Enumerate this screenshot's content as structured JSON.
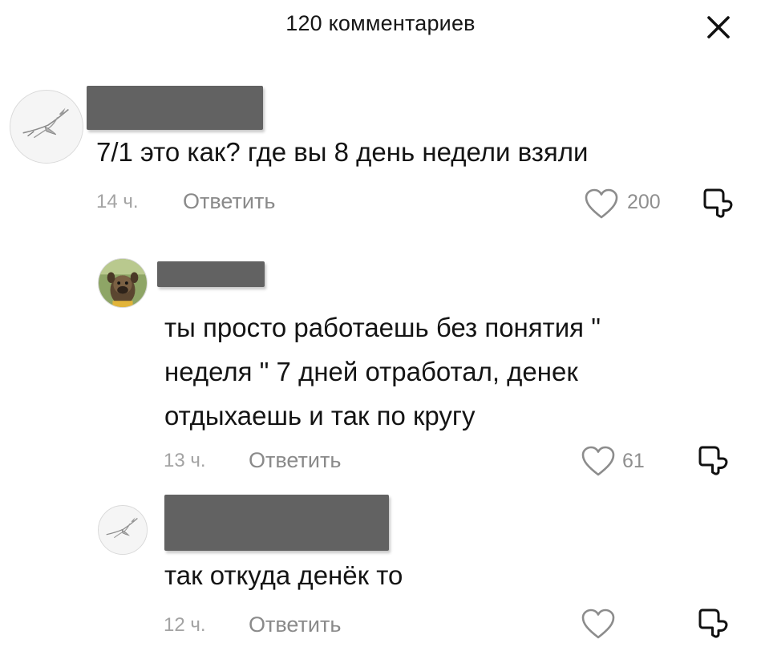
{
  "header": {
    "title": "120 комментариев"
  },
  "comments": [
    {
      "text_lines": [
        "7/1 это как? где вы 8 день недели взяли"
      ],
      "time": "14 ч.",
      "reply_label": "Ответить",
      "likes": "200",
      "avatar_icon": "bird-sketch-avatar"
    },
    {
      "text_lines": [
        "ты просто работаешь без понятия \"",
        "неделя \" 7 дней отработал, денек",
        "отдыхаешь и так по кругу"
      ],
      "time": "13 ч.",
      "reply_label": "Ответить",
      "likes": "61",
      "avatar_icon": "dog-photo-avatar"
    },
    {
      "text_lines": [
        "так откуда денёк то"
      ],
      "time": "12 ч.",
      "reply_label": "Ответить",
      "likes": "",
      "avatar_icon": "bird-sketch-avatar"
    }
  ],
  "icons": {
    "close": "close-icon",
    "like": "heart-outline-icon",
    "dislike": "thumbs-down-icon"
  },
  "colors": {
    "text": "#141414",
    "secondary_text": "#8a8a8a",
    "redaction": "#626262"
  }
}
